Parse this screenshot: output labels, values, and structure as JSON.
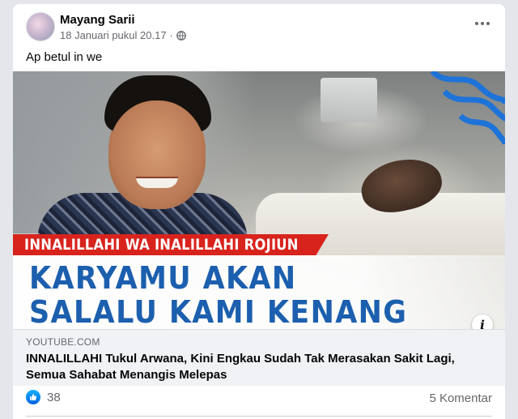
{
  "post": {
    "author": "Mayang Sarii",
    "timestamp": "18 Januari pukul 20.17",
    "separator": "·",
    "audience_icon": "globe-icon",
    "more_icon": "more-options-icon",
    "text": "Ap betul in we"
  },
  "media": {
    "banner_text": "INNALILLAHI WA INALILLAHI ROJIUN",
    "headline_line1": "KARYAMU AKAN",
    "headline_line2": "SALALU KAMI KENANG",
    "info_label": "i"
  },
  "link_preview": {
    "domain": "YOUTUBE.COM",
    "title": "INNALILLAHI Tukul Arwana, Kini Engkau Sudah Tak Merasakan Sakit Lagi, Semua Sahabat Menangis Melepas"
  },
  "footer": {
    "like_count": "38",
    "comments": "5 Komentar"
  },
  "colors": {
    "like_blue": "#1877f2",
    "headline_blue": "#1c5fae",
    "banner_red": "#d8231d"
  }
}
